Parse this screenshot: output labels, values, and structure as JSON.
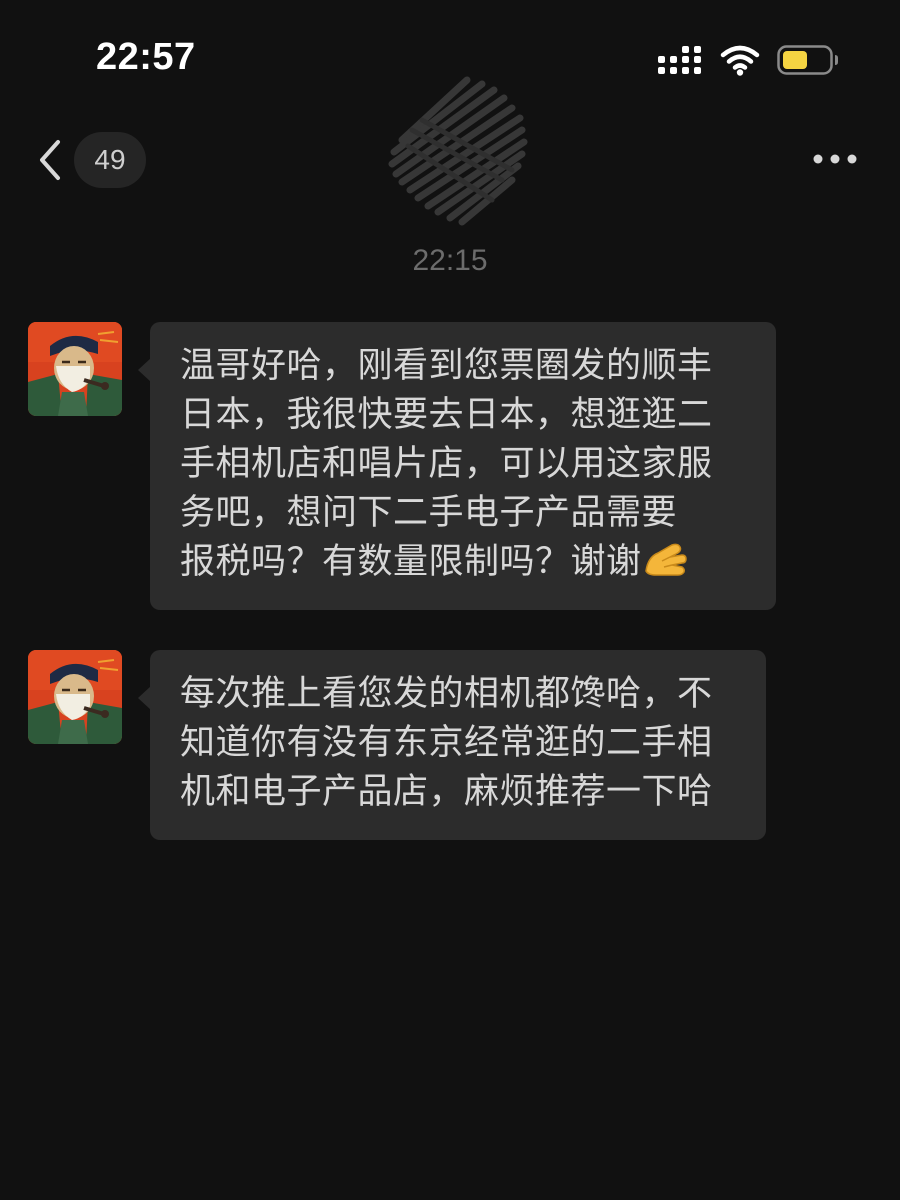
{
  "status_bar": {
    "time": "22:57",
    "icons": [
      "signal-icon",
      "wifi-icon",
      "battery-icon"
    ],
    "battery_color": "#f5d442"
  },
  "nav": {
    "back_icon": "chevron-left-icon",
    "unread_count": "49",
    "more_icon": "more-icon"
  },
  "chat": {
    "timestamp": "22:15",
    "messages": [
      {
        "sender": "contact",
        "avatar_icon": "avatar-portrait",
        "lines": [
          "温哥好哈，刚看到您票圈发的顺丰",
          "日本，我很快要去日本，想逛逛二",
          "手相机店和唱片店，可以用这家服",
          "务吧，想问下二手电子产品需要",
          "报税吗？有数量限制吗？谢谢"
        ],
        "trailing_emoji": "pinched-fingers-emoji"
      },
      {
        "sender": "contact",
        "avatar_icon": "avatar-portrait",
        "lines": [
          "每次推上看您发的相机都馋哈，不",
          "知道你有没有东京经常逛的二手相",
          "机和电子产品店，麻烦推荐一下哈"
        ]
      }
    ]
  },
  "colors": {
    "background": "#111111",
    "bubble": "#2c2c2c",
    "text": "#d8d8d8",
    "timestamp": "#6c6c6c"
  }
}
